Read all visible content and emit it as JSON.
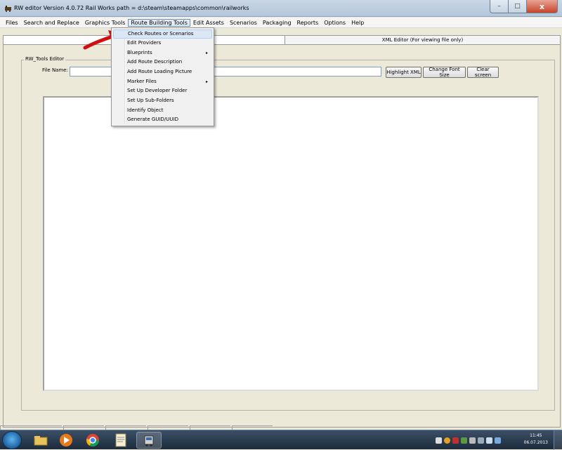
{
  "window": {
    "title": "RW editor  Version 4.0.72   Rail Works path = d:\\steam\\steamapps\\common\\railworks",
    "controls": {
      "minimize": "–",
      "maximize": "□",
      "close": "x"
    }
  },
  "menubar": {
    "items": [
      {
        "label": "Files"
      },
      {
        "label": "Search and Replace"
      },
      {
        "label": "Graphics Tools"
      },
      {
        "label": "Route Building Tools",
        "open": true
      },
      {
        "label": "Edit Assets"
      },
      {
        "label": "Scenarios"
      },
      {
        "label": "Packaging"
      },
      {
        "label": "Reports"
      },
      {
        "label": "Options"
      },
      {
        "label": "Help"
      }
    ]
  },
  "dropdown": {
    "items": [
      {
        "label": "Check Routes or Scenarios",
        "highlighted": true,
        "submenu": false
      },
      {
        "label": "Edit Providers",
        "submenu": false
      },
      {
        "label": "Blueprints",
        "submenu": true
      },
      {
        "label": "Add Route Description",
        "submenu": false
      },
      {
        "label": "Add Route Loading Picture",
        "submenu": false
      },
      {
        "label": "Marker Files",
        "submenu": true
      },
      {
        "label": "Set Up Developer Folder",
        "submenu": false
      },
      {
        "label": "Set Up Sub-Folders",
        "submenu": false
      },
      {
        "label": "Identify Object",
        "submenu": false
      },
      {
        "label": "Generate GUID/UUID",
        "submenu": false
      }
    ],
    "submenu_arrow": "▸"
  },
  "tabs": {
    "xml_editor": "XML Editor (For viewing file only)"
  },
  "editor_panel": {
    "group_title": "RW_Tools Editor",
    "file_name_label": "File Name:",
    "file_name_value": "",
    "buttons": {
      "highlight": "Highlight XML",
      "font_size": "Change Font Size",
      "clear": "Clear screen"
    }
  },
  "taskbar": {
    "clock_time": "11:45",
    "clock_date": "06.07.2013",
    "apps": [
      "explorer-icon",
      "media-player-icon",
      "chrome-icon",
      "notepad-icon",
      "rw-editor-icon"
    ]
  },
  "colors": {
    "annotation_arrow": "#d01010",
    "menu_highlight": "#dbe7f5"
  }
}
